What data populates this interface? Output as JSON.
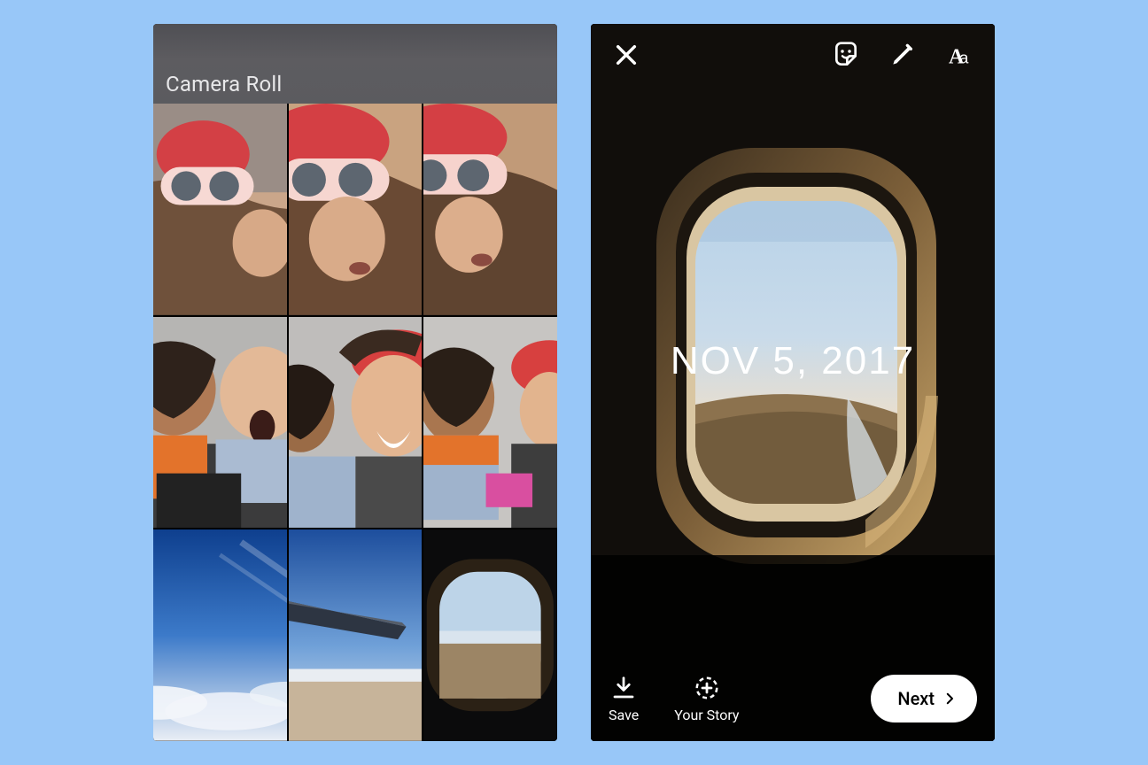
{
  "picker": {
    "title": "Camera Roll",
    "thumbs": [
      "selfie-heart-mask-1",
      "selfie-heart-mask-2",
      "selfie-heart-mask-3",
      "group-laughing-1",
      "group-laughing-2",
      "group-laughing-3",
      "sky-clouds",
      "plane-wing",
      "plane-window"
    ]
  },
  "editor": {
    "date_label": "NOV 5, 2017",
    "save_label": "Save",
    "your_story_label": "Your Story",
    "next_label": "Next"
  }
}
